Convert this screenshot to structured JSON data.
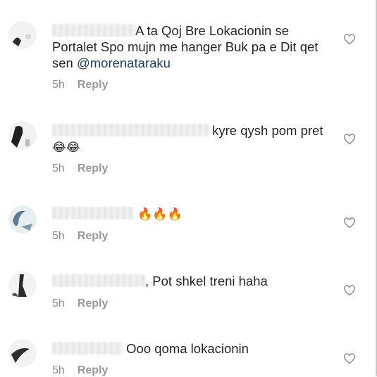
{
  "comments": [
    {
      "text": "A ta Qoj Bre Lokacionin se Portalet Spo mujn me hanger Buk pa e Dit qet sen ",
      "mention": "@morenataraku",
      "emojis": "",
      "time": "5h",
      "reply_label": "Reply",
      "avatar_icon": "avatar-icon",
      "like_icon": "heart-outline-icon"
    },
    {
      "text": " kyre qysh pom pret ",
      "mention": "",
      "emojis": "😂😂",
      "time": "5h",
      "reply_label": "Reply",
      "avatar_icon": "avatar-icon",
      "like_icon": "heart-outline-icon"
    },
    {
      "text": " ",
      "mention": "",
      "emojis": "🔥🔥🔥",
      "time": "5h",
      "reply_label": "Reply",
      "avatar_icon": "avatar-icon",
      "like_icon": "heart-outline-icon"
    },
    {
      "text": ", Pot shkel treni haha",
      "mention": "",
      "emojis": "",
      "time": "5h",
      "reply_label": "Reply",
      "avatar_icon": "avatar-icon",
      "like_icon": "heart-outline-icon"
    },
    {
      "text": " Ooo qoma lokacionin",
      "mention": "",
      "emojis": "",
      "time": "5h",
      "reply_label": "Reply",
      "avatar_icon": "avatar-icon",
      "like_icon": "heart-outline-icon"
    }
  ],
  "colors": {
    "text": "#262626",
    "meta": "#8e8e8e",
    "mention": "#1d3f63",
    "heart": "#8e8e8e"
  }
}
